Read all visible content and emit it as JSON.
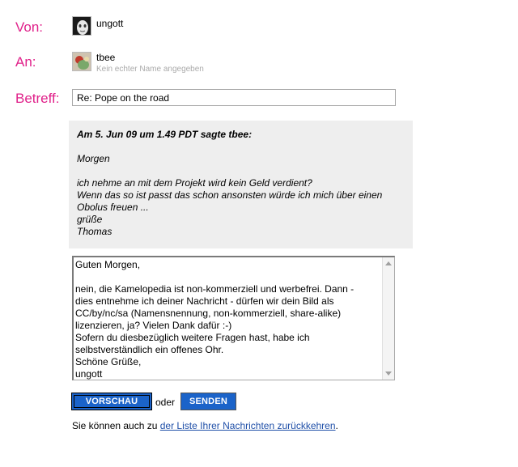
{
  "from": {
    "label": "Von:",
    "user": "ungott"
  },
  "to": {
    "label": "An:",
    "user": "tbee",
    "note": "Kein echter Name angegeben"
  },
  "subject": {
    "label": "Betreff:",
    "value": "Re: Pope on the road"
  },
  "quote": {
    "header": "Am 5. Jun 09 um 1.49 PDT sagte tbee:",
    "lines": [
      "",
      "Morgen",
      "",
      "ich nehme an mit dem Projekt wird kein Geld verdient?",
      "Wenn das so ist passt das schon ansonsten würde ich mich über einen",
      "Obolus freuen ...",
      "grüße",
      "Thomas"
    ]
  },
  "message": {
    "lines": [
      "Guten Morgen,",
      "",
      "nein, die Kamelopedia ist non-kommerziell und werbefrei. Dann -",
      "dies entnehme ich deiner Nachricht - dürfen wir dein Bild als",
      "CC/by/nc/sa (Namensnennung, non-kommerziell, share-alike)",
      "lizenzieren, ja? Vielen Dank dafür :-)",
      "Sofern du diesbezüglich weitere Fragen hast, habe ich",
      "selbstverständlich ein offenes Ohr.",
      "Schöne Grüße,",
      "ungott"
    ]
  },
  "actions": {
    "preview": "VORSCHAU",
    "or": "oder",
    "send": "SENDEN"
  },
  "footer": {
    "prefix": "Sie können auch zu ",
    "link": "der Liste Ihrer Nachrichten zurückkehren",
    "suffix": "."
  },
  "colors": {
    "label": "#e0218a",
    "button": "#1b63c9",
    "quote_bg": "#eeeeee",
    "link": "#1f4fa8"
  }
}
